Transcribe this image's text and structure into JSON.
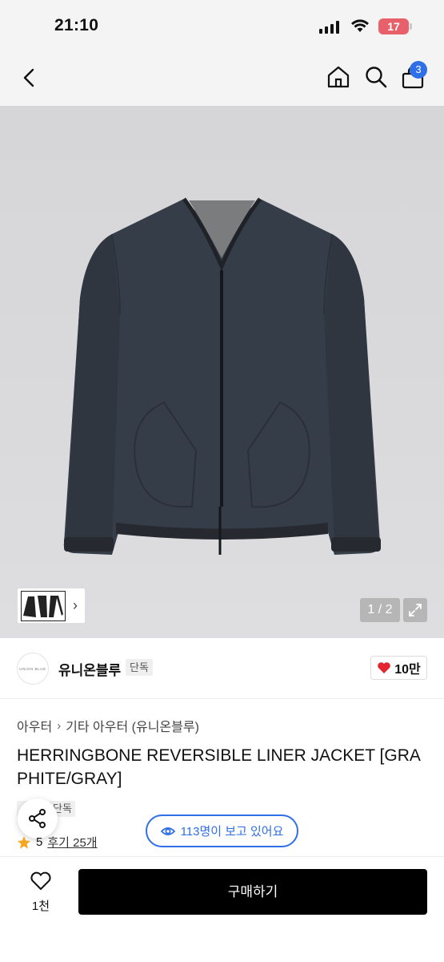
{
  "status": {
    "time": "21:10",
    "battery": "17"
  },
  "header": {
    "cart_count": "3",
    "icons": [
      "back-icon",
      "home-icon",
      "search-icon",
      "cart-icon"
    ]
  },
  "gallery": {
    "page_indicator": "1 / 2"
  },
  "seller": {
    "logo_text": "UNION BLUE",
    "name": "유니온블루",
    "tag": "단독",
    "likes": "10만"
  },
  "breadcrumb": {
    "level1": "아우터",
    "level2": "기타 아우터 (유니온블루)"
  },
  "product": {
    "title": "HERRINGBONE REVERSIBLE LINER JACKET [GRAPHITE/GRAY]",
    "tag": "단독",
    "rating": "5",
    "reviews": "후기 25개",
    "viewers": "113명이 보고 있어요"
  },
  "bottom": {
    "wish_count": "1천",
    "buy_label": "구매하기"
  },
  "colors": {
    "accent_blue": "#2f6fe8",
    "heart_red": "#e3262f",
    "star": "#f5a623"
  }
}
